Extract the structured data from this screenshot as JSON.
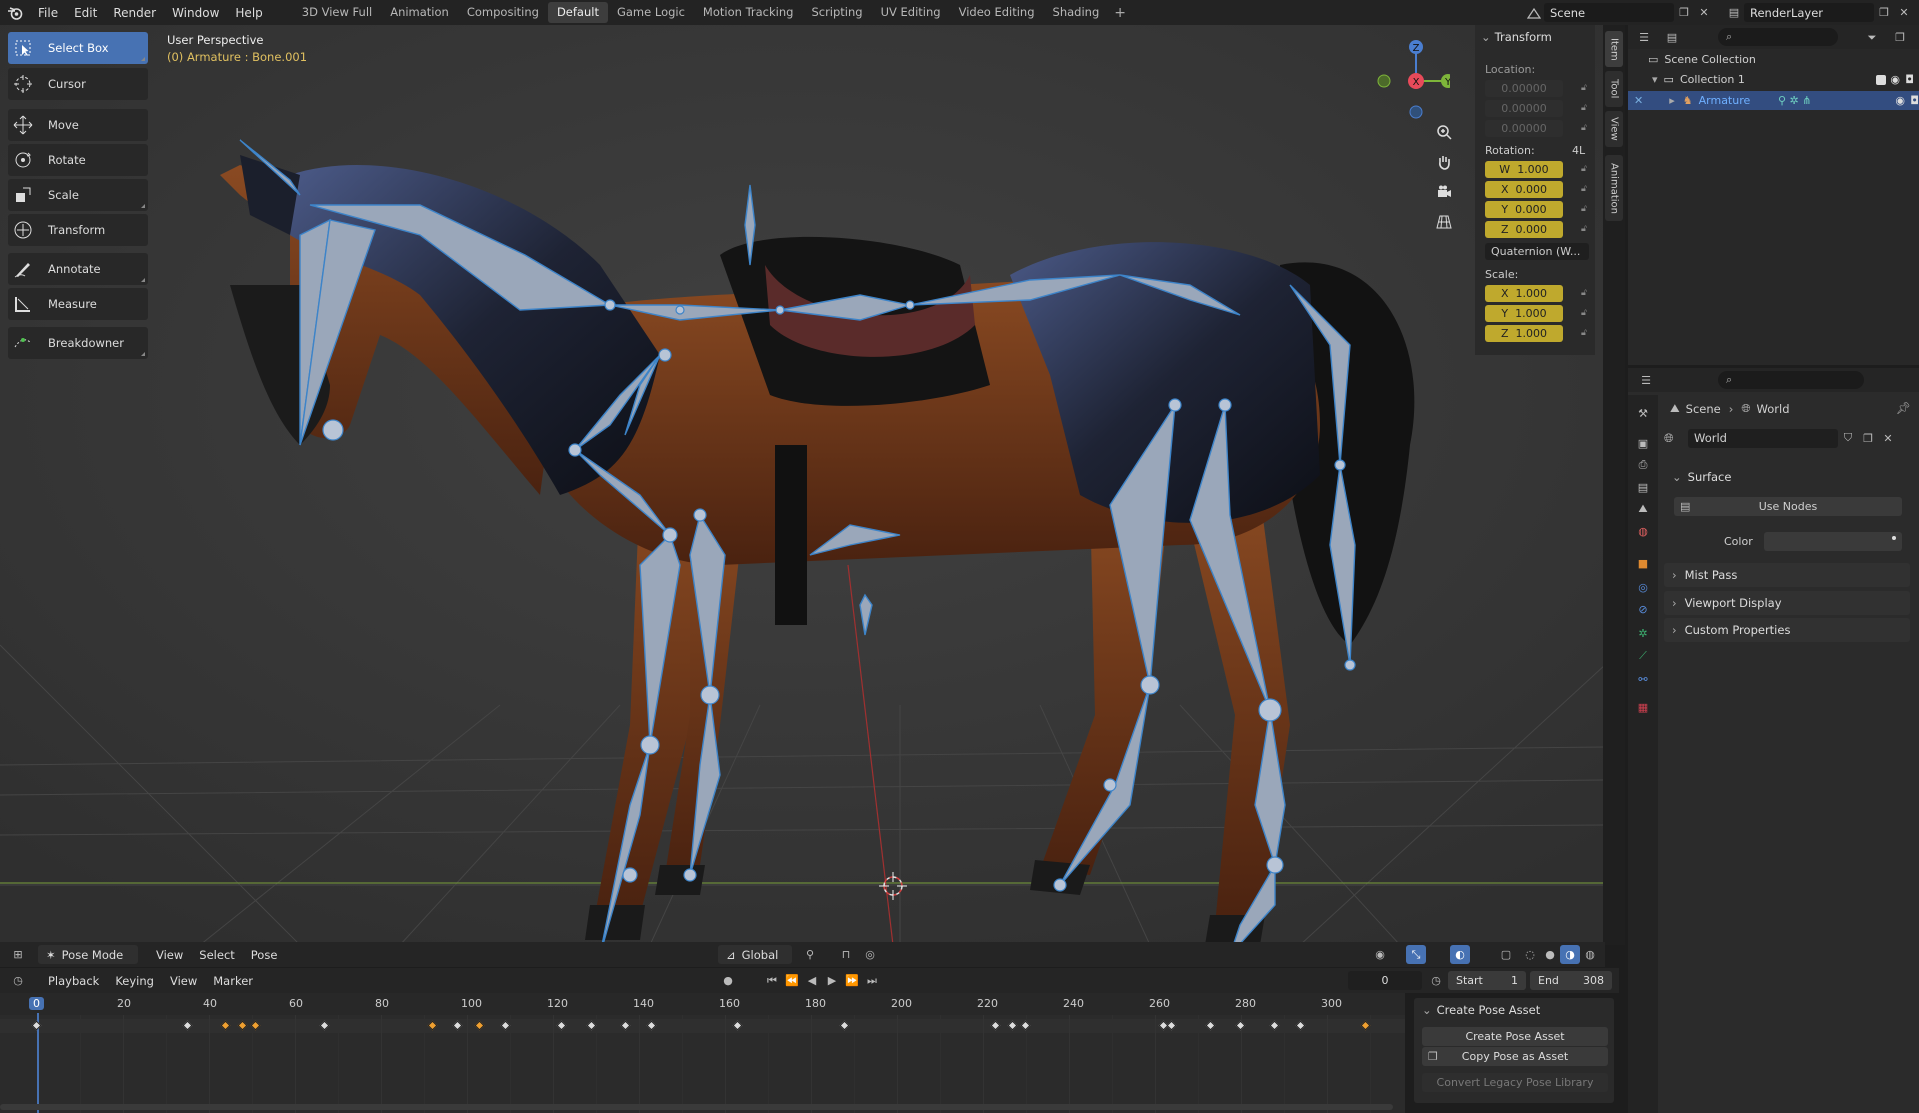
{
  "topbar": {
    "menus": [
      "File",
      "Edit",
      "Render",
      "Window",
      "Help"
    ],
    "workspaces": [
      "3D View Full",
      "Animation",
      "Compositing",
      "Default",
      "Game Logic",
      "Motion Tracking",
      "Scripting",
      "UV Editing",
      "Video Editing",
      "Shading"
    ],
    "active_workspace": "Default",
    "add_tab": "+",
    "scene": "Scene",
    "render_layer": "RenderLayer"
  },
  "toolbar": {
    "tools": [
      "Select Box",
      "Cursor",
      "Move",
      "Rotate",
      "Scale",
      "Transform",
      "Annotate",
      "Measure",
      "Breakdowner"
    ],
    "active": "Select Box"
  },
  "viewport": {
    "title": "User Perspective",
    "subtitle": "(0) Armature : Bone.001",
    "gizmo": {
      "z": "Z",
      "x": "X",
      "y": "Y"
    }
  },
  "transform_panel": {
    "title": "Transform",
    "location_label": "Location:",
    "location": [
      "0.00000",
      "0.00000",
      "0.00000"
    ],
    "rotation_label": "Rotation:",
    "rotation_mode_short": "4L",
    "rotation": [
      {
        "axis": "W",
        "value": "1.000"
      },
      {
        "axis": "X",
        "value": "0.000"
      },
      {
        "axis": "Y",
        "value": "0.000"
      },
      {
        "axis": "Z",
        "value": "0.000"
      }
    ],
    "rotation_mode": "Quaternion (W...",
    "scale_label": "Scale:",
    "scale": [
      {
        "axis": "X",
        "value": "1.000"
      },
      {
        "axis": "Y",
        "value": "1.000"
      },
      {
        "axis": "Z",
        "value": "1.000"
      }
    ]
  },
  "side_tabs": [
    "Item",
    "Tool",
    "View",
    "Animation"
  ],
  "outliner": {
    "scene_collection": "Scene Collection",
    "collection": "Collection 1",
    "armature": "Armature"
  },
  "properties": {
    "breadcrumb_scene": "Scene",
    "breadcrumb_world": "World",
    "world_name": "World",
    "surface_label": "Surface",
    "use_nodes": "Use Nodes",
    "color_label": "Color",
    "sections": [
      "Mist Pass",
      "Viewport Display",
      "Custom Properties"
    ]
  },
  "viewport_header": {
    "mode": "Pose Mode",
    "menus": [
      "View",
      "Select",
      "Pose"
    ],
    "orientation": "Global"
  },
  "timeline_header": {
    "menus": [
      "Playback",
      "Keying",
      "View",
      "Marker"
    ],
    "current_frame": "0",
    "start_label": "Start",
    "start": "1",
    "end_label": "End",
    "end": "308"
  },
  "timeline": {
    "ruler_labels": [
      "0",
      "20",
      "40",
      "60",
      "80",
      "100",
      "120",
      "140",
      "160",
      "180",
      "200",
      "220",
      "240",
      "260",
      "280",
      "300"
    ],
    "current_frame": "0",
    "keyframes": [
      {
        "frame": 35,
        "sel": false
      },
      {
        "frame": 44,
        "sel": true
      },
      {
        "frame": 48,
        "sel": true
      },
      {
        "frame": 51,
        "sel": true
      },
      {
        "frame": 67,
        "sel": false
      },
      {
        "frame": 92,
        "sel": true
      },
      {
        "frame": 98,
        "sel": false
      },
      {
        "frame": 103,
        "sel": true
      },
      {
        "frame": 109,
        "sel": false
      },
      {
        "frame": 122,
        "sel": false
      },
      {
        "frame": 129,
        "sel": false
      },
      {
        "frame": 137,
        "sel": false
      },
      {
        "frame": 143,
        "sel": false
      },
      {
        "frame": 163,
        "sel": false
      },
      {
        "frame": 188,
        "sel": false
      },
      {
        "frame": 223,
        "sel": false
      },
      {
        "frame": 227,
        "sel": false
      },
      {
        "frame": 230,
        "sel": false
      },
      {
        "frame": 262,
        "sel": false
      },
      {
        "frame": 264,
        "sel": false
      },
      {
        "frame": 273,
        "sel": false
      },
      {
        "frame": 280,
        "sel": false
      },
      {
        "frame": 288,
        "sel": false
      },
      {
        "frame": 294,
        "sel": false
      },
      {
        "frame": 309,
        "sel": true
      }
    ]
  },
  "create_pose_asset": {
    "title": "Create Pose Asset",
    "btn_create": "Create Pose Asset",
    "btn_copy": "Copy Pose as Asset",
    "btn_convert": "Convert Legacy Pose Library"
  },
  "colors": {
    "accent": "#4772b3",
    "keyframe": "#f0a030",
    "transform_field": "#bfa92d"
  }
}
